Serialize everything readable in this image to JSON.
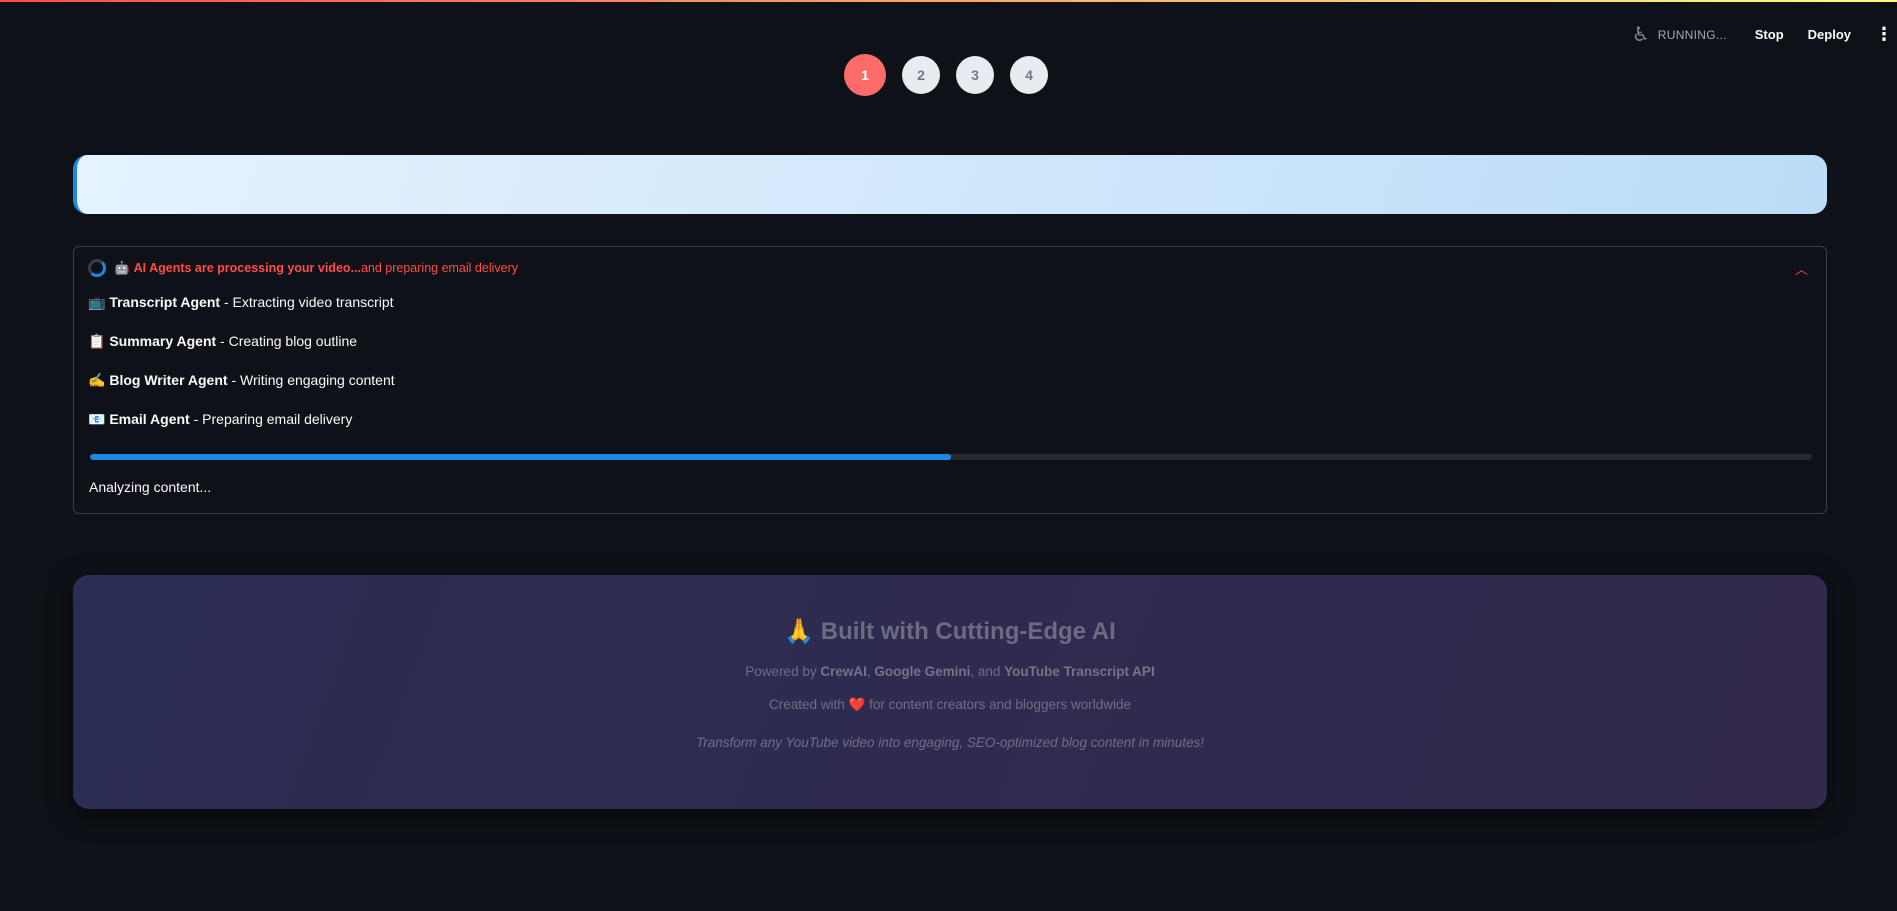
{
  "header": {
    "status": "RUNNING...",
    "stop_label": "Stop",
    "deploy_label": "Deploy",
    "menu_icon": "kebab-icon",
    "status_icon": "accessibility-running-icon"
  },
  "steps": {
    "items": [
      "1",
      "2",
      "3",
      "4"
    ],
    "active": "1",
    "active_color": "#ff6b6b"
  },
  "processing": {
    "icon": "🤖",
    "title_bold": "AI Agents are processing your video...",
    "title_rest": " and preparing email delivery",
    "agents": [
      {
        "icon": "📺",
        "name": "Transcript Agent",
        "desc": " - Extracting video transcript"
      },
      {
        "icon": "📋",
        "name": "Summary Agent",
        "desc": " - Creating blog outline"
      },
      {
        "icon": "✍️",
        "name": "Blog Writer Agent",
        "desc": " - Writing engaging content"
      },
      {
        "icon": "📧",
        "name": "Email Agent",
        "desc": " - Preparing email delivery"
      }
    ],
    "progress_percent": 50,
    "progress_color": "#1e88e5",
    "status_text": "Analyzing content..."
  },
  "footer": {
    "title_icon": "🙏",
    "title": "Built with Cutting-Edge AI",
    "powered_prefix": "Powered by ",
    "crewai": "CrewAI",
    "sep1": ", ",
    "gemini": "Google Gemini",
    "sep2": ", and ",
    "yt": "YouTube Transcript API",
    "created_prefix": "Created with ",
    "heart": "❤️",
    "created_suffix": " for content creators and bloggers worldwide",
    "tagline": "Transform any YouTube video into engaging, SEO-optimized blog content in minutes!"
  }
}
